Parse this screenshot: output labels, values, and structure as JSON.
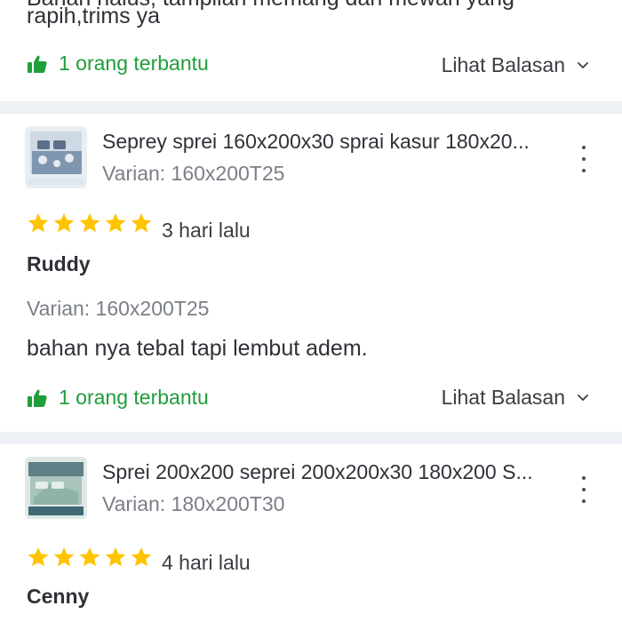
{
  "review_prev": {
    "text_partial": "Bahan halus, tampilan memang dan mewah yang",
    "text_last_line": "rapih,trims ya",
    "helpful_label": "1 orang terbantu",
    "reply_label": "Lihat Balasan"
  },
  "reviews": [
    {
      "product_title": "Seprey sprei 160x200x30 sprai kasur 180x20...",
      "product_variant": "Varian: 160x200T25",
      "rating": 5,
      "time_ago": "3 hari lalu",
      "user": "Ruddy",
      "variant": "Varian: 160x200T25",
      "text": "bahan nya tebal tapi lembut adem.",
      "helpful_label": "1 orang terbantu",
      "reply_label": "Lihat Balasan"
    },
    {
      "product_title": "Sprei 200x200 seprei 200x200x30 180x200 S...",
      "product_variant": "Varian: 180x200T30",
      "rating": 5,
      "time_ago": "4 hari lalu",
      "user": "Cenny"
    }
  ],
  "colors": {
    "helpful_green": "#1f9e3a",
    "star_yellow": "#ffc400",
    "separator": "#eef1f5",
    "muted_text": "#7a7f87"
  },
  "icons": {
    "helpful": "thumbs-up-icon",
    "reply": "chevron-down-icon",
    "menu": "kebab-menu-icon",
    "rating": "star-icon"
  }
}
